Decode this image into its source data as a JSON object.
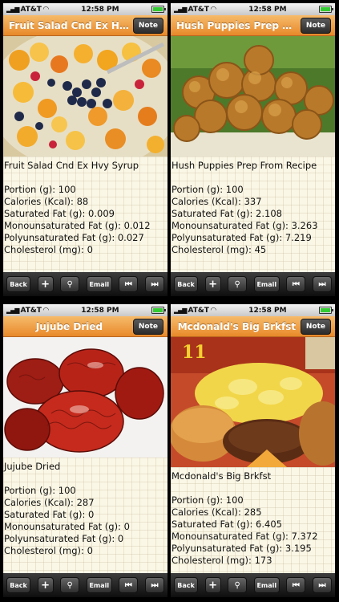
{
  "status": {
    "carrier": "AT&T",
    "time": "12:58 PM"
  },
  "toolbar": {
    "back": "Back",
    "add": "+",
    "email": "Email",
    "search_icon": "search-icon",
    "prev_icon": "skip-previous-icon",
    "next_icon": "skip-next-icon"
  },
  "note_label": "Note",
  "screens": [
    {
      "nav_title": "Fruit Salad Cnd Ex Hvy Syrup",
      "food_name": "Fruit Salad Cnd Ex Hvy Syrup",
      "photo": "fruit-salad-photo",
      "lines": [
        "Portion (g): 100",
        "Calories (Kcal): 88",
        "Saturated Fat (g): 0.009",
        "Monounsaturated Fat (g): 0.012",
        "Polyunsaturated Fat (g): 0.027",
        "Cholesterol (mg): 0"
      ]
    },
    {
      "nav_title": "Hush Puppies Prep From Recipe",
      "food_name": "Hush Puppies Prep From Recipe",
      "photo": "hush-puppies-photo",
      "lines": [
        "Portion (g): 100",
        "Calories (Kcal): 337",
        "Saturated Fat (g): 2.108",
        "Monounsaturated Fat (g): 3.263",
        "Polyunsaturated Fat (g): 7.219",
        "Cholesterol (mg): 45"
      ]
    },
    {
      "nav_title": "Jujube Dried",
      "food_name": "Jujube Dried",
      "photo": "jujube-photo",
      "lines": [
        "Portion (g): 100",
        "Calories (Kcal): 287",
        "Saturated Fat (g): 0",
        "Monounsaturated Fat (g): 0",
        "Polyunsaturated Fat (g): 0",
        "Cholesterol (mg): 0"
      ]
    },
    {
      "nav_title": "Mcdonald's Big Brkfst",
      "food_name": "Mcdonald's Big Brkfst",
      "photo": "big-breakfast-photo",
      "photo_label": "11",
      "lines": [
        "Portion (g): 100",
        "Calories (Kcal): 285",
        "Saturated Fat (g): 6.405",
        "Monounsaturated Fat (g): 7.372",
        "Polyunsaturated Fat (g): 3.195",
        "Cholesterol (mg): 173"
      ]
    }
  ]
}
